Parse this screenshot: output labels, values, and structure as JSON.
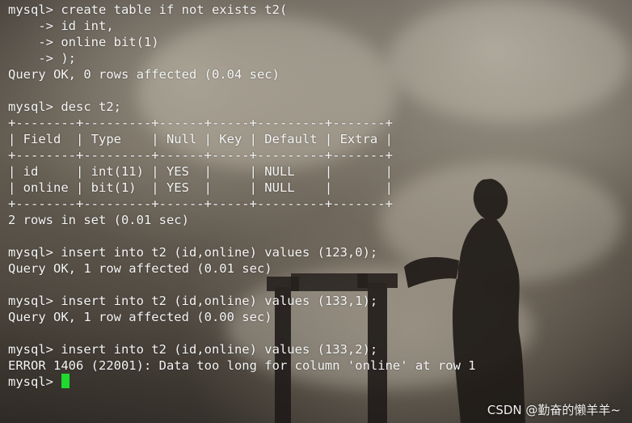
{
  "terminal": {
    "lines": [
      "mysql> create table if not exists t2(",
      "    -> id int,",
      "    -> online bit(1)",
      "    -> );",
      "Query OK, 0 rows affected (0.04 sec)",
      "",
      "mysql> desc t2;",
      "+--------+---------+------+-----+---------+-------+",
      "| Field  | Type    | Null | Key | Default | Extra |",
      "+--------+---------+------+-----+---------+-------+",
      "| id     | int(11) | YES  |     | NULL    |       |",
      "| online | bit(1)  | YES  |     | NULL    |       |",
      "+--------+---------+------+-----+---------+-------+",
      "2 rows in set (0.01 sec)",
      "",
      "mysql> insert into t2 (id,online) values (123,0);",
      "Query OK, 1 row affected (0.01 sec)",
      "",
      "mysql> insert into t2 (id,online) values (133,1);",
      "Query OK, 1 row affected (0.00 sec)",
      "",
      "mysql> insert into t2 (id,online) values (133,2);",
      "ERROR 1406 (22001): Data too long for column 'online' at row 1"
    ],
    "prompt": "mysql> ",
    "cursor_color": "#1fd92f",
    "text_color": "#f4f4f4"
  },
  "watermark": {
    "text": "CSDN @勤奋的懒羊羊~"
  }
}
